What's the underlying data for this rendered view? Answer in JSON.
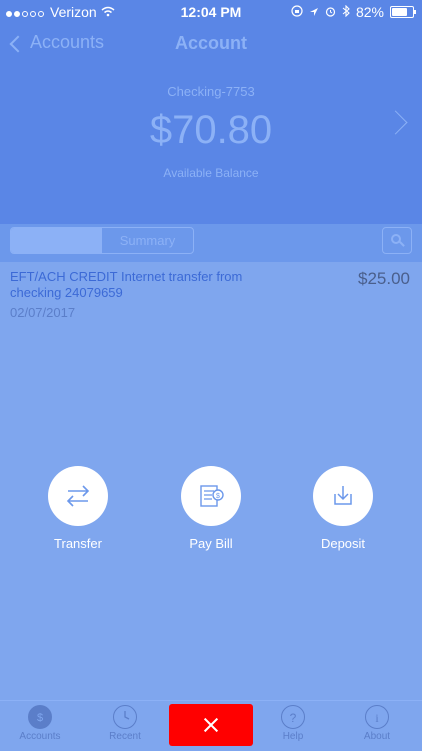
{
  "status_bar": {
    "carrier": "Verizon",
    "time": "12:04 PM",
    "battery_percent": "82%",
    "battery_level": 0.82
  },
  "nav": {
    "back_label": "Accounts",
    "title": "Account"
  },
  "account": {
    "name": "Checking-7753",
    "balance": "$70.80",
    "balance_label": "Available Balance"
  },
  "tabs": {
    "active_label": "",
    "summary_label": "Summary"
  },
  "transactions": [
    {
      "description": "EFT/ACH CREDIT Internet transfer from checking 24079659",
      "date": "02/07/2017",
      "amount": "$25.00"
    }
  ],
  "actions": [
    {
      "label": "Transfer",
      "icon": "transfer-arrows-icon"
    },
    {
      "label": "Pay Bill",
      "icon": "bill-icon"
    },
    {
      "label": "Deposit",
      "icon": "download-tray-icon"
    }
  ],
  "tab_bar": [
    {
      "label": "Accounts",
      "icon": "dollar-icon"
    },
    {
      "label": "Recent",
      "icon": "clock-icon"
    },
    {
      "label": "Help",
      "icon": "question-icon"
    },
    {
      "label": "About",
      "icon": "info-icon"
    }
  ],
  "colors": {
    "header_blue": "#5a86e6",
    "overlay_blue": "#7fa6ee",
    "close_red": "#ff0000"
  }
}
